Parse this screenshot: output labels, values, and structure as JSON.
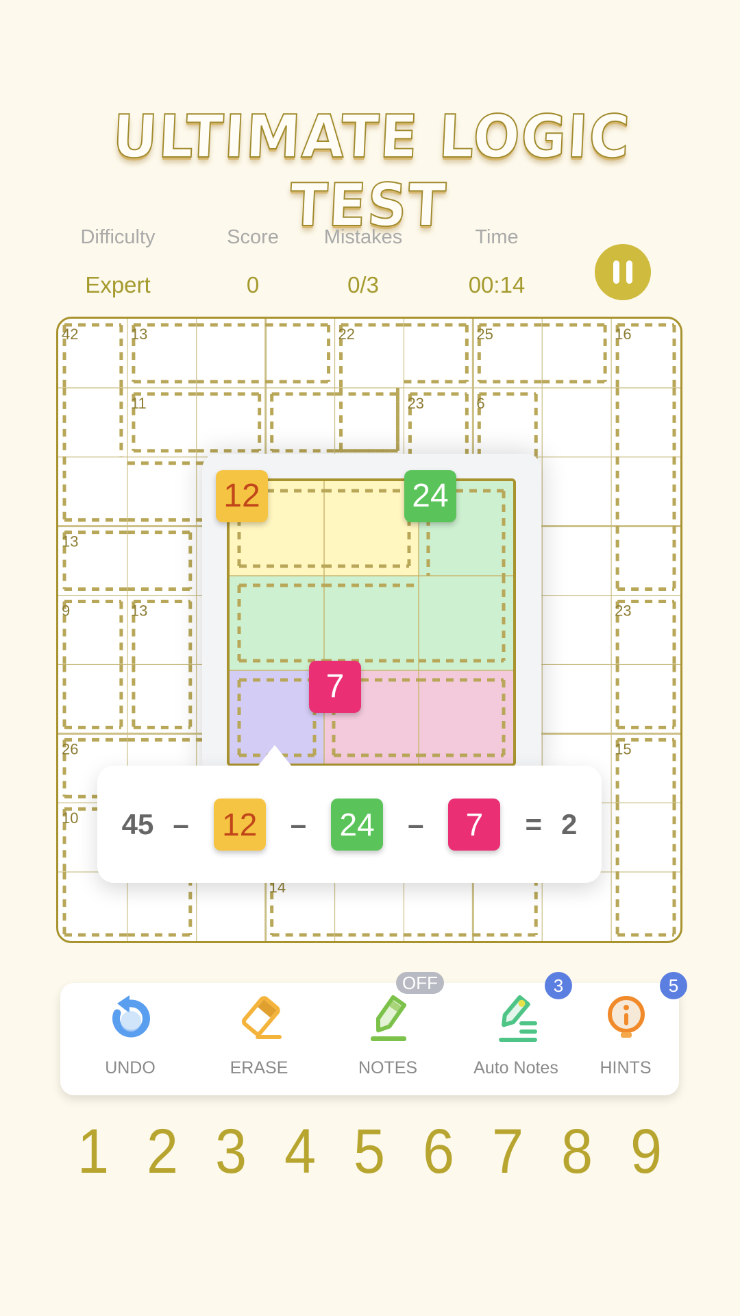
{
  "title": "ULTIMATE LOGIC TEST",
  "stats": [
    {
      "label": "Difficulty",
      "value": "Expert"
    },
    {
      "label": "Score",
      "value": "0"
    },
    {
      "label": "Mistakes",
      "value": "0/3"
    },
    {
      "label": "Time",
      "value": "00:14"
    }
  ],
  "pause_icon": "pause-icon",
  "board": {
    "size": 9,
    "colors": {
      "border": "#a8932e",
      "grid": "#cbbf86",
      "cage": "#b8a758",
      "clue": "#8c7c32"
    },
    "cages": [
      {
        "sum": "42",
        "cells": [
          [
            0,
            0
          ],
          [
            1,
            0
          ],
          [
            2,
            0
          ],
          [
            2,
            1
          ],
          [
            2,
            2
          ]
        ]
      },
      {
        "sum": "13",
        "cells": [
          [
            0,
            1
          ],
          [
            0,
            2
          ],
          [
            0,
            3
          ]
        ]
      },
      {
        "sum": "22",
        "cells": [
          [
            0,
            4
          ],
          [
            0,
            5
          ],
          [
            1,
            4
          ]
        ]
      },
      {
        "sum": "25",
        "cells": [
          [
            0,
            6
          ],
          [
            0,
            7
          ]
        ]
      },
      {
        "sum": "16",
        "cells": [
          [
            0,
            8
          ],
          [
            1,
            8
          ],
          [
            2,
            8
          ],
          [
            3,
            8
          ]
        ]
      },
      {
        "sum": "11",
        "cells": [
          [
            1,
            1
          ],
          [
            1,
            2
          ]
        ]
      },
      {
        "sum": "",
        "cells": [
          [
            1,
            3
          ],
          [
            1,
            4
          ]
        ]
      },
      {
        "sum": "23",
        "cells": [
          [
            1,
            5
          ],
          [
            2,
            5
          ]
        ]
      },
      {
        "sum": "6",
        "cells": [
          [
            1,
            6
          ],
          [
            2,
            6
          ]
        ]
      },
      {
        "sum": "13",
        "cells": [
          [
            3,
            0
          ],
          [
            3,
            1
          ]
        ]
      },
      {
        "sum": "9",
        "cells": [
          [
            4,
            0
          ],
          [
            5,
            0
          ]
        ]
      },
      {
        "sum": "13",
        "cells": [
          [
            4,
            1
          ],
          [
            5,
            1
          ]
        ]
      },
      {
        "sum": "23",
        "cells": [
          [
            4,
            8
          ],
          [
            5,
            8
          ]
        ]
      },
      {
        "sum": "26",
        "cells": [
          [
            6,
            0
          ],
          [
            6,
            1
          ],
          [
            6,
            2
          ]
        ]
      },
      {
        "sum": "15",
        "cells": [
          [
            6,
            8
          ],
          [
            7,
            8
          ],
          [
            8,
            8
          ]
        ]
      },
      {
        "sum": "10",
        "cells": [
          [
            7,
            0
          ],
          [
            8,
            0
          ],
          [
            8,
            1
          ]
        ]
      },
      {
        "sum": "14",
        "cells": [
          [
            8,
            3
          ],
          [
            8,
            4
          ],
          [
            8,
            5
          ],
          [
            8,
            6
          ]
        ]
      }
    ]
  },
  "popup": {
    "regions": [
      {
        "name": "yellow",
        "color": "#fff6c0",
        "cells": [
          [
            0,
            0
          ],
          [
            0,
            1
          ]
        ]
      },
      {
        "name": "green",
        "color": "#cdf0d0",
        "cells": [
          [
            0,
            2
          ],
          [
            1,
            0
          ],
          [
            1,
            1
          ],
          [
            1,
            2
          ]
        ]
      },
      {
        "name": "purple",
        "color": "#d3ccf5",
        "cells": [
          [
            2,
            0
          ]
        ]
      },
      {
        "name": "pink",
        "color": "#f3c9dc",
        "cells": [
          [
            2,
            1
          ],
          [
            2,
            2
          ]
        ]
      }
    ],
    "badges": [
      {
        "value": "12",
        "bg": "#f6c443",
        "fg": "#c0461a"
      },
      {
        "value": "24",
        "bg": "#5ac45a",
        "fg": "#ffffff"
      },
      {
        "value": "7",
        "bg": "#ea2f74",
        "fg": "#ffffff"
      }
    ]
  },
  "equation": {
    "total": "45",
    "minus": "–",
    "equals": "=",
    "result": "2"
  },
  "toolbar": [
    {
      "label": "UNDO",
      "icon": "undo-icon",
      "color": "#5a9ef0"
    },
    {
      "label": "ERASE",
      "icon": "eraser-icon",
      "color": "#f4b43c"
    },
    {
      "label": "NOTES",
      "icon": "pencil-icon",
      "color": "#7cc24a",
      "tag": "OFF"
    },
    {
      "label": "Auto Notes",
      "icon": "auto-notes-icon",
      "color": "#4fc487",
      "tag": "3"
    },
    {
      "label": "HINTS",
      "icon": "lightbulb-icon",
      "color": "#f08a2a",
      "tag": "5"
    }
  ],
  "numpad": [
    "1",
    "2",
    "3",
    "4",
    "5",
    "6",
    "7",
    "8",
    "9"
  ]
}
